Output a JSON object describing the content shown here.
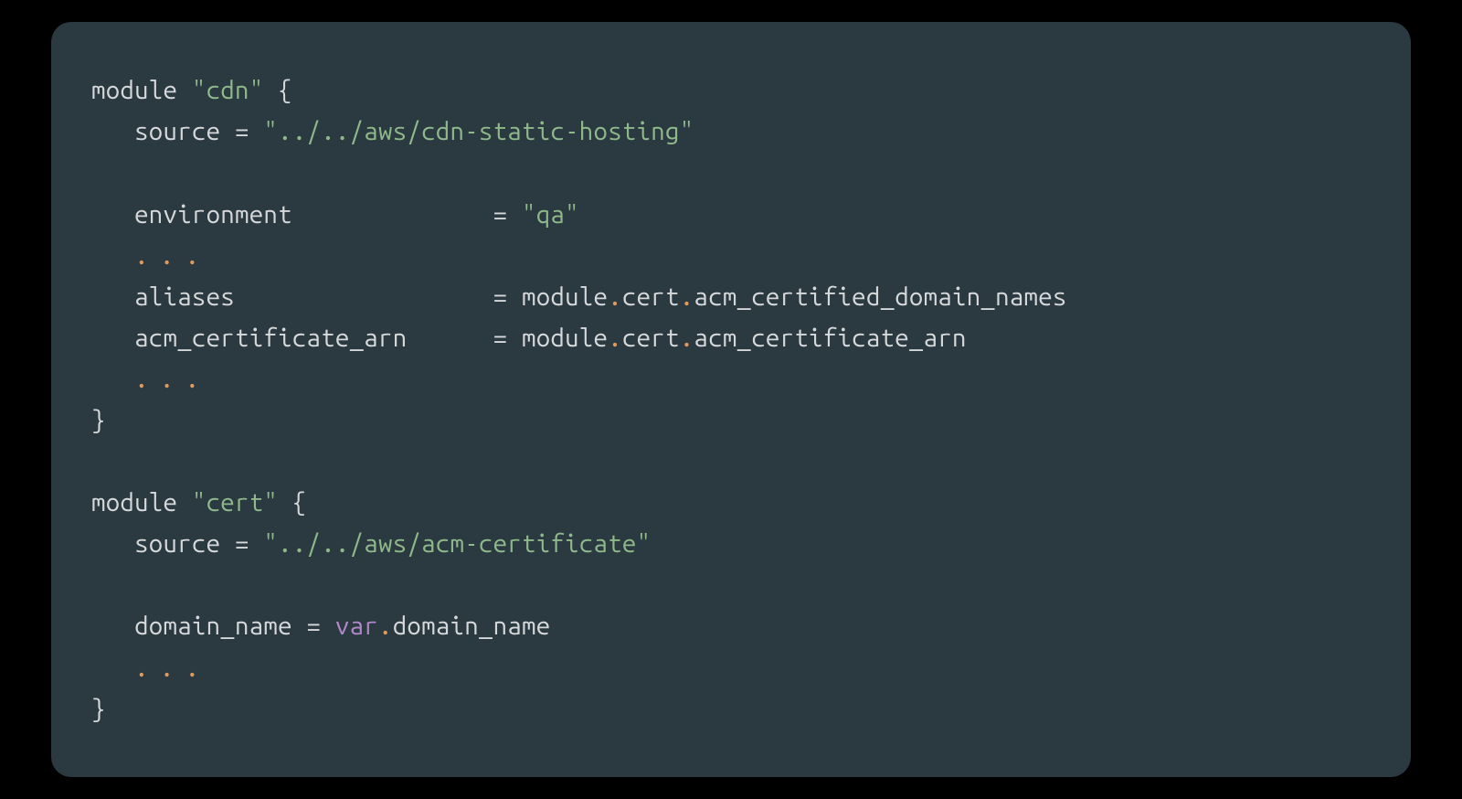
{
  "code": {
    "lines": [
      [
        {
          "cls": "tok-keyword",
          "text": "module "
        },
        {
          "cls": "tok-string",
          "text": "\"cdn\""
        },
        {
          "cls": "tok-punct",
          "text": " {"
        }
      ],
      [
        {
          "cls": "tok-ident",
          "text": "   source = "
        },
        {
          "cls": "tok-string",
          "text": "\"../../aws/cdn-static-hosting\""
        }
      ],
      [],
      [
        {
          "cls": "tok-ident",
          "text": "   environment              = "
        },
        {
          "cls": "tok-string",
          "text": "\"qa\""
        }
      ],
      [
        {
          "cls": "tok-ident",
          "text": "   "
        },
        {
          "cls": "tok-ellipsis",
          "text": "..."
        }
      ],
      [
        {
          "cls": "tok-ident",
          "text": "   aliases                  = module"
        },
        {
          "cls": "tok-dot",
          "text": "."
        },
        {
          "cls": "tok-ident",
          "text": "cert"
        },
        {
          "cls": "tok-dot",
          "text": "."
        },
        {
          "cls": "tok-ident",
          "text": "acm_certified_domain_names"
        }
      ],
      [
        {
          "cls": "tok-ident",
          "text": "   acm_certificate_arn      = module"
        },
        {
          "cls": "tok-dot",
          "text": "."
        },
        {
          "cls": "tok-ident",
          "text": "cert"
        },
        {
          "cls": "tok-dot",
          "text": "."
        },
        {
          "cls": "tok-ident",
          "text": "acm_certificate_arn"
        }
      ],
      [
        {
          "cls": "tok-ident",
          "text": "   "
        },
        {
          "cls": "tok-ellipsis",
          "text": "..."
        }
      ],
      [
        {
          "cls": "tok-punct",
          "text": "}"
        }
      ],
      [],
      [
        {
          "cls": "tok-keyword",
          "text": "module "
        },
        {
          "cls": "tok-string",
          "text": "\"cert\""
        },
        {
          "cls": "tok-punct",
          "text": " {"
        }
      ],
      [
        {
          "cls": "tok-ident",
          "text": "   source = "
        },
        {
          "cls": "tok-string",
          "text": "\"../../aws/acm-certificate\""
        }
      ],
      [],
      [
        {
          "cls": "tok-ident",
          "text": "   domain_name = "
        },
        {
          "cls": "tok-var",
          "text": "var"
        },
        {
          "cls": "tok-dot",
          "text": "."
        },
        {
          "cls": "tok-ident",
          "text": "domain_name"
        }
      ],
      [
        {
          "cls": "tok-ident",
          "text": "   "
        },
        {
          "cls": "tok-ellipsis",
          "text": "..."
        }
      ],
      [
        {
          "cls": "tok-punct",
          "text": "}"
        }
      ]
    ]
  }
}
